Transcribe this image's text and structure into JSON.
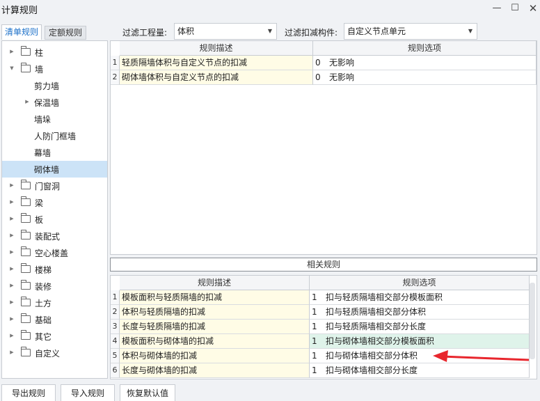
{
  "window": {
    "title": "计算规则",
    "min": "—",
    "max": "☐",
    "close": "✕"
  },
  "tabs": [
    {
      "label": "清单规则",
      "active": true
    },
    {
      "label": "定额规则",
      "active": false
    }
  ],
  "filters": {
    "quantity_label": "过滤工程量:",
    "quantity_value": "体积",
    "component_label": "过滤扣减构件:",
    "component_value": "自定义节点单元"
  },
  "tree": [
    {
      "label": "柱",
      "level": 0,
      "expander": "collapsed",
      "folder": true
    },
    {
      "label": "墙",
      "level": 0,
      "expander": "expanded",
      "folder": true
    },
    {
      "label": "剪力墙",
      "level": 1,
      "expander": "none",
      "folder": false
    },
    {
      "label": "保温墙",
      "level": 1,
      "expander": "collapsed",
      "folder": false
    },
    {
      "label": "墙垛",
      "level": 1,
      "expander": "none",
      "folder": false
    },
    {
      "label": "人防门框墙",
      "level": 1,
      "expander": "none",
      "folder": false
    },
    {
      "label": "幕墙",
      "level": 1,
      "expander": "none",
      "folder": false
    },
    {
      "label": "砌体墙",
      "level": 1,
      "expander": "none",
      "folder": false,
      "selected": true
    },
    {
      "label": "门窗洞",
      "level": 0,
      "expander": "collapsed",
      "folder": true
    },
    {
      "label": "梁",
      "level": 0,
      "expander": "collapsed",
      "folder": true
    },
    {
      "label": "板",
      "level": 0,
      "expander": "collapsed",
      "folder": true
    },
    {
      "label": "装配式",
      "level": 0,
      "expander": "collapsed",
      "folder": true
    },
    {
      "label": "空心楼盖",
      "level": 0,
      "expander": "collapsed",
      "folder": true
    },
    {
      "label": "楼梯",
      "level": 0,
      "expander": "collapsed",
      "folder": true
    },
    {
      "label": "装修",
      "level": 0,
      "expander": "collapsed",
      "folder": true
    },
    {
      "label": "土方",
      "level": 0,
      "expander": "collapsed",
      "folder": true
    },
    {
      "label": "基础",
      "level": 0,
      "expander": "collapsed",
      "folder": true
    },
    {
      "label": "其它",
      "level": 0,
      "expander": "collapsed",
      "folder": true
    },
    {
      "label": "自定义",
      "level": 0,
      "expander": "collapsed",
      "folder": true
    }
  ],
  "top_table": {
    "headers": [
      "规则描述",
      "规则选项"
    ],
    "rows": [
      {
        "no": "1",
        "desc": "轻质隔墙体积与自定义节点的扣减",
        "opt_code": "0",
        "opt_text": "无影响"
      },
      {
        "no": "2",
        "desc": "砌体墙体积与自定义节点的扣减",
        "opt_code": "0",
        "opt_text": "无影响"
      }
    ]
  },
  "related_label": "相关规则",
  "bottom_table": {
    "headers": [
      "规则描述",
      "规则选项"
    ],
    "rows": [
      {
        "no": "1",
        "desc": "模板面积与轻质隔墙的扣减",
        "opt_code": "1",
        "opt_text": "扣与轻质隔墙相交部分模板面积"
      },
      {
        "no": "2",
        "desc": "体积与轻质隔墙的扣减",
        "opt_code": "1",
        "opt_text": "扣与轻质隔墙相交部分体积"
      },
      {
        "no": "3",
        "desc": "长度与轻质隔墙的扣减",
        "opt_code": "1",
        "opt_text": "扣与轻质隔墙相交部分长度"
      },
      {
        "no": "4",
        "desc": "模板面积与砌体墙的扣减",
        "opt_code": "1",
        "opt_text": "扣与砌体墙相交部分模板面积",
        "highlighted": true
      },
      {
        "no": "5",
        "desc": "体积与砌体墙的扣减",
        "opt_code": "1",
        "opt_text": "扣与砌体墙相交部分体积"
      },
      {
        "no": "6",
        "desc": "长度与砌体墙的扣减",
        "opt_code": "1",
        "opt_text": "扣与砌体墙相交部分长度"
      }
    ]
  },
  "buttons": {
    "export": "导出规则",
    "import": "导入规则",
    "restore": "恢复默认值"
  },
  "colors": {
    "accent": "#1a6fc8",
    "arrow": "#e8262d",
    "selected_row": "#cce3f7",
    "desc_cell": "#fffce6",
    "highlight_cell": "#dff3ea"
  }
}
